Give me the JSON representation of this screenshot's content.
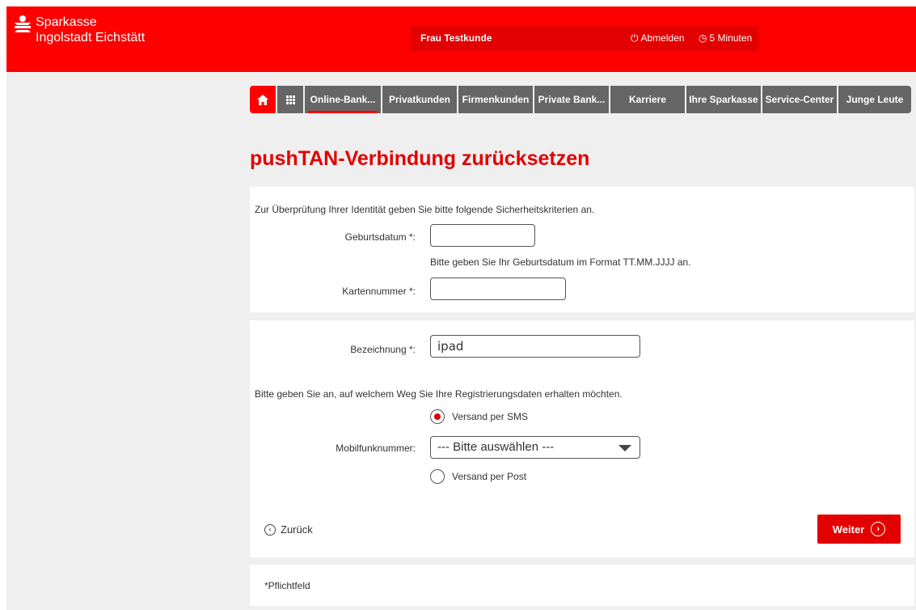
{
  "header": {
    "brand_line1": "Sparkasse",
    "brand_line2": "Ingolstadt Eichstätt",
    "user_name": "Frau Testkunde",
    "logout_label": "Abmelden",
    "session_timer": "5 Minuten"
  },
  "nav": {
    "items": [
      {
        "label": "Online-Bank..."
      },
      {
        "label": "Privatkunden"
      },
      {
        "label": "Firmenkunden"
      },
      {
        "label": "Private Bank..."
      },
      {
        "label": "Karriere"
      },
      {
        "label": "Ihre Sparkasse"
      },
      {
        "label": "Service-Center"
      },
      {
        "label": "Junge Leute"
      }
    ]
  },
  "page": {
    "title": "pushTAN-Verbindung zurücksetzen"
  },
  "identity": {
    "intro": "Zur Überprüfung Ihrer Identität geben Sie bitte folgende Sicherheitskriterien an.",
    "birthdate_label": "Geburtsdatum *:",
    "birthdate_value": "",
    "birthdate_hint": "Bitte geben Sie Ihr Geburtsdatum im Format TT.MM.JJJJ an.",
    "card_label": "Kartennummer *:",
    "card_value": ""
  },
  "registration": {
    "name_label": "Bezeichnung *:",
    "name_value": "ipad",
    "delivery_prompt": "Bitte geben Sie an, auf welchem Weg Sie Ihre Registrierungsdaten erhalten möchten.",
    "option_sms": "Versand per SMS",
    "mobile_label": "Mobilfunknummer:",
    "mobile_selected": "--- Bitte auswählen ---",
    "option_post": "Versand per Post",
    "back_label": "Zurück",
    "next_label": "Weiter"
  },
  "footer": {
    "required_note": "*Pflichtfeld"
  },
  "colors": {
    "brand_red": "#ff0000",
    "nav_gray": "#666666",
    "title_red": "#e20000"
  }
}
